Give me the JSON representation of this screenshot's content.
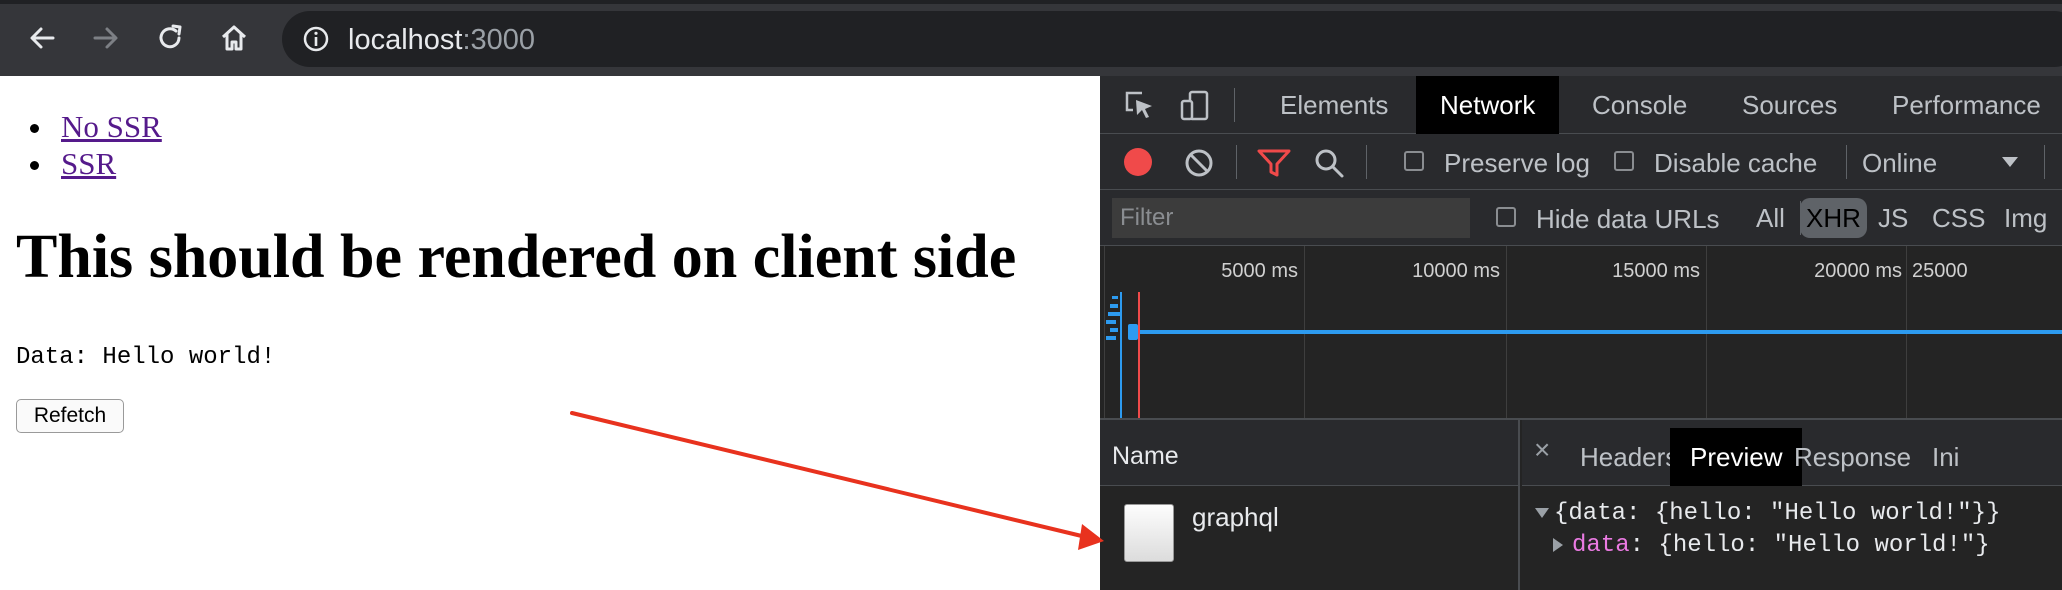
{
  "browser": {
    "url_host": "localhost",
    "url_port": ":3000"
  },
  "page": {
    "nav_links": [
      "No SSR",
      "SSR"
    ],
    "title": "This should be rendered on client side",
    "data_line": "Data: Hello world!",
    "refetch_label": "Refetch"
  },
  "devtools": {
    "tabs": [
      "Elements",
      "Network",
      "Console",
      "Sources",
      "Performance"
    ],
    "active_tab": "Network",
    "toolbar": {
      "preserve_log_label": "Preserve log",
      "disable_cache_label": "Disable cache",
      "throttle_value": "Online"
    },
    "filter": {
      "placeholder": "Filter",
      "hide_data_urls_label": "Hide data URLs",
      "types": [
        "All",
        "XHR",
        "JS",
        "CSS",
        "Img"
      ],
      "active_type": "XHR"
    },
    "timeline": {
      "ticks": [
        "5000 ms",
        "10000 ms",
        "15000 ms",
        "20000 ms",
        "25000"
      ]
    },
    "requests": {
      "name_header": "Name",
      "rows": [
        "graphql"
      ]
    },
    "details": {
      "close_glyph": "×",
      "tabs": [
        "Headers",
        "Preview",
        "Response",
        "Ini"
      ],
      "active_tab": "Preview",
      "preview_summary": "{data: {hello: \"Hello world!\"}}",
      "preview_key": "data",
      "preview_value": ": {hello: \"Hello world!\"}"
    }
  },
  "colors": {
    "record": "#f04a4a",
    "filter_icon": "#f04a4a",
    "timeline_bar": "#2d9bf0",
    "arrow": "#e8321e",
    "preview_key": "#ea7ae2"
  }
}
